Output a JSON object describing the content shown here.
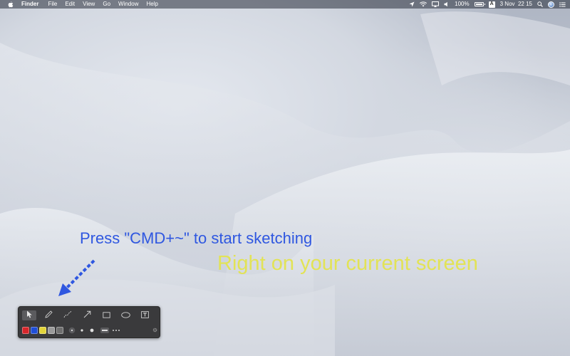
{
  "menubar": {
    "app_name": "Finder",
    "menus": [
      "File",
      "Edit",
      "View",
      "Go",
      "Window",
      "Help"
    ],
    "battery_text": "100%",
    "battery_level": 1.0,
    "input_source": "A",
    "datetime": "3 Nov  22 15"
  },
  "overlay": {
    "hint": "Press \"CMD+~\" to start sketching",
    "tagline": "Right on your current screen"
  },
  "toolbar": {
    "tools": [
      {
        "name": "pointer",
        "icon": "cursor-arrow-icon",
        "selected": true
      },
      {
        "name": "pen",
        "icon": "pen-icon",
        "selected": false
      },
      {
        "name": "curve",
        "icon": "curve-line-icon",
        "selected": false
      },
      {
        "name": "arrow",
        "icon": "arrow-icon",
        "selected": false
      },
      {
        "name": "rectangle",
        "icon": "rectangle-icon",
        "selected": false
      },
      {
        "name": "ellipse",
        "icon": "ellipse-icon",
        "selected": false
      },
      {
        "name": "text",
        "icon": "text-box-icon",
        "selected": false
      }
    ],
    "colors": [
      "#d6262b",
      "#1f4ed6",
      "#e2d43a",
      "#9a9a9a",
      "#6f6f6f"
    ],
    "accent_colors": {
      "hint_text": "#2f57e0",
      "tagline_text": "#e2e356",
      "toolbar_bg": "#3a3a3c"
    }
  }
}
